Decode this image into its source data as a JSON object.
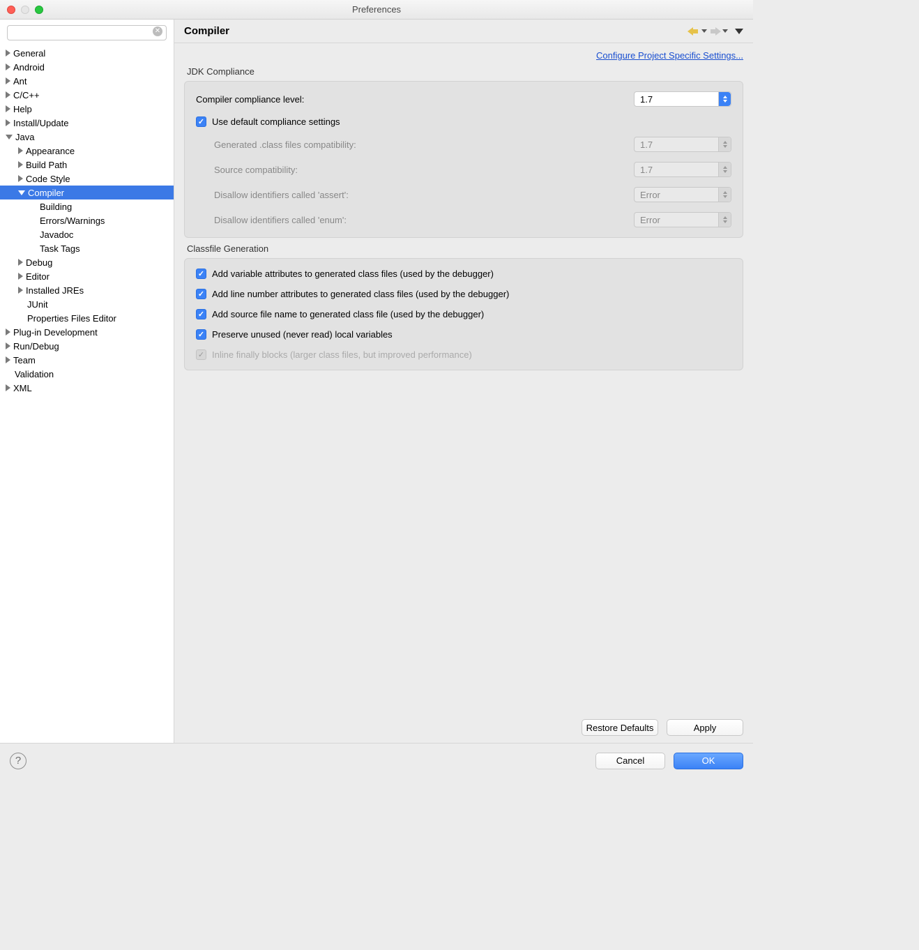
{
  "window": {
    "title": "Preferences"
  },
  "sidebar": {
    "filter_placeholder": "",
    "items": [
      {
        "label": "General",
        "depth": 0,
        "arrow": "right"
      },
      {
        "label": "Android",
        "depth": 0,
        "arrow": "right"
      },
      {
        "label": "Ant",
        "depth": 0,
        "arrow": "right"
      },
      {
        "label": "C/C++",
        "depth": 0,
        "arrow": "right"
      },
      {
        "label": "Help",
        "depth": 0,
        "arrow": "right"
      },
      {
        "label": "Install/Update",
        "depth": 0,
        "arrow": "right"
      },
      {
        "label": "Java",
        "depth": 0,
        "arrow": "down"
      },
      {
        "label": "Appearance",
        "depth": 1,
        "arrow": "right"
      },
      {
        "label": "Build Path",
        "depth": 1,
        "arrow": "right"
      },
      {
        "label": "Code Style",
        "depth": 1,
        "arrow": "right"
      },
      {
        "label": "Compiler",
        "depth": 1,
        "arrow": "down",
        "selected": true
      },
      {
        "label": "Building",
        "depth": 2,
        "arrow": "none"
      },
      {
        "label": "Errors/Warnings",
        "depth": 2,
        "arrow": "none"
      },
      {
        "label": "Javadoc",
        "depth": 2,
        "arrow": "none"
      },
      {
        "label": "Task Tags",
        "depth": 2,
        "arrow": "none"
      },
      {
        "label": "Debug",
        "depth": 1,
        "arrow": "right"
      },
      {
        "label": "Editor",
        "depth": 1,
        "arrow": "right"
      },
      {
        "label": "Installed JREs",
        "depth": 1,
        "arrow": "right"
      },
      {
        "label": "JUnit",
        "depth": 1,
        "arrow": "none"
      },
      {
        "label": "Properties Files Editor",
        "depth": 1,
        "arrow": "none"
      },
      {
        "label": "Plug-in Development",
        "depth": 0,
        "arrow": "right"
      },
      {
        "label": "Run/Debug",
        "depth": 0,
        "arrow": "right"
      },
      {
        "label": "Team",
        "depth": 0,
        "arrow": "right"
      },
      {
        "label": "Validation",
        "depth": 0,
        "arrow": "none"
      },
      {
        "label": "XML",
        "depth": 0,
        "arrow": "right"
      }
    ]
  },
  "main": {
    "title": "Compiler",
    "project_link": "Configure Project Specific Settings...",
    "jdk": {
      "section": "JDK Compliance",
      "compliance_label": "Compiler compliance level:",
      "compliance_value": "1.7",
      "use_default_label": "Use default compliance settings",
      "generated_label": "Generated .class files compatibility:",
      "generated_value": "1.7",
      "source_label": "Source compatibility:",
      "source_value": "1.7",
      "assert_label": "Disallow identifiers called 'assert':",
      "assert_value": "Error",
      "enum_label": "Disallow identifiers called 'enum':",
      "enum_value": "Error"
    },
    "classfile": {
      "section": "Classfile Generation",
      "c1": "Add variable attributes to generated class files (used by the debugger)",
      "c2": "Add line number attributes to generated class files (used by the debugger)",
      "c3": "Add source file name to generated class file (used by the debugger)",
      "c4": "Preserve unused (never read) local variables",
      "c5": "Inline finally blocks (larger class files, but improved performance)"
    },
    "buttons": {
      "restore": "Restore Defaults",
      "apply": "Apply"
    }
  },
  "footer": {
    "cancel": "Cancel",
    "ok": "OK"
  }
}
